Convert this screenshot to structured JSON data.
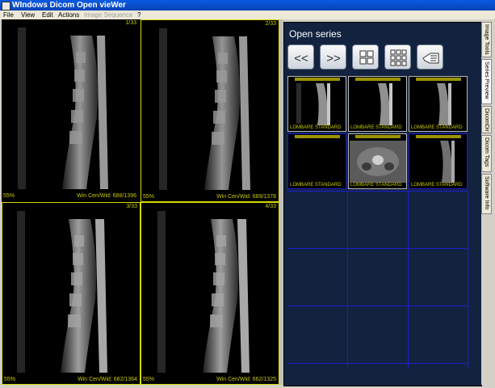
{
  "window": {
    "title": "WIndows Dicom Open vieWer"
  },
  "menu": {
    "file": "File",
    "view": "View",
    "edit": "Edit",
    "actions": "Actions",
    "image_sequence": "Image Sequence",
    "help": "?"
  },
  "viewports": [
    {
      "index": "1/33",
      "zoom": "55%",
      "wl": "Win Cen/Wid: 688/1396"
    },
    {
      "index": "2/33",
      "zoom": "55%",
      "wl": "Win Cen/Wid: 689/1378"
    },
    {
      "index": "3/33",
      "zoom": "55%",
      "wl": "Win Cen/Wid: 682/1364"
    },
    {
      "index": "4/33",
      "zoom": "55%",
      "wl": "Win Cen/Wid: 662/1325"
    }
  ],
  "panel": {
    "title": "Open series"
  },
  "toolbar": {
    "prev": "<<",
    "next": ">>",
    "layout2x2": "grid-2x2-icon",
    "layout3x3": "grid-3x3-icon",
    "hand": "hand-pointer-icon"
  },
  "series": [
    {
      "label": "LOMBARE STANDARD"
    },
    {
      "label": "LOMBARE STANDARD"
    },
    {
      "label": "LOMBARE STANDARD"
    },
    {
      "label": "LOMBARE STANDARD"
    },
    {
      "label": "LOMBARE STANDARD"
    },
    {
      "label": "LOMBARE STANDARD"
    }
  ],
  "tabs": [
    "Image Tools",
    "Series Preview",
    "DicomDir",
    "Dicom Tags",
    "Software Info"
  ],
  "colors": {
    "overlay": "#c8c800",
    "panel": "#13233f",
    "grid": "#1c1ccc",
    "title": "#0a5ae0"
  }
}
